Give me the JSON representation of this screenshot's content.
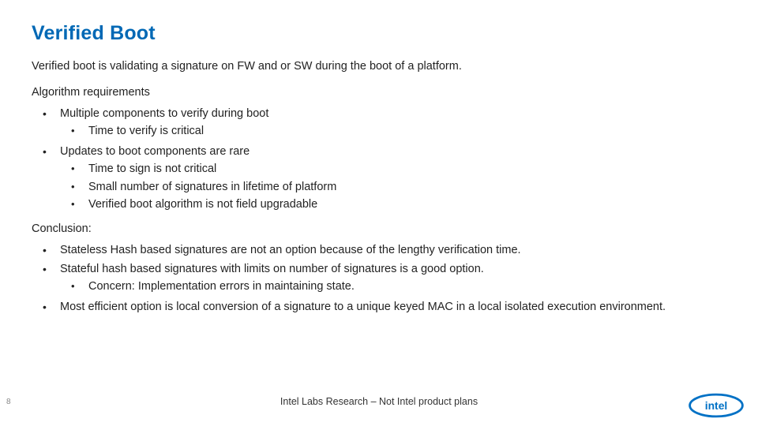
{
  "title": "Verified Boot",
  "intro": "Verified boot is validating a signature on FW and or SW during the boot of a platform.",
  "algo_label": "Algorithm requirements",
  "algo": [
    {
      "text": "Multiple components to verify during boot",
      "sub": [
        "Time to verify is critical"
      ]
    },
    {
      "text": "Updates to boot components are rare",
      "sub": [
        "Time to sign is not critical",
        "Small number of signatures in lifetime of platform",
        "Verified boot algorithm is not field upgradable"
      ]
    }
  ],
  "concl_label": "Conclusion:",
  "concl": [
    {
      "text": "Stateless Hash based signatures are not an option because of the lengthy verification time.",
      "sub": []
    },
    {
      "text": "Stateful hash based signatures with limits on number of signatures is a good option.",
      "sub": [
        "Concern: Implementation errors in maintaining state."
      ]
    },
    {
      "text": "Most efficient option is local conversion of a signature to a unique keyed MAC in a local isolated execution environment.",
      "sub": []
    }
  ],
  "footer": "Intel Labs Research – Not Intel product plans",
  "page": "8",
  "logo_text": "intel"
}
